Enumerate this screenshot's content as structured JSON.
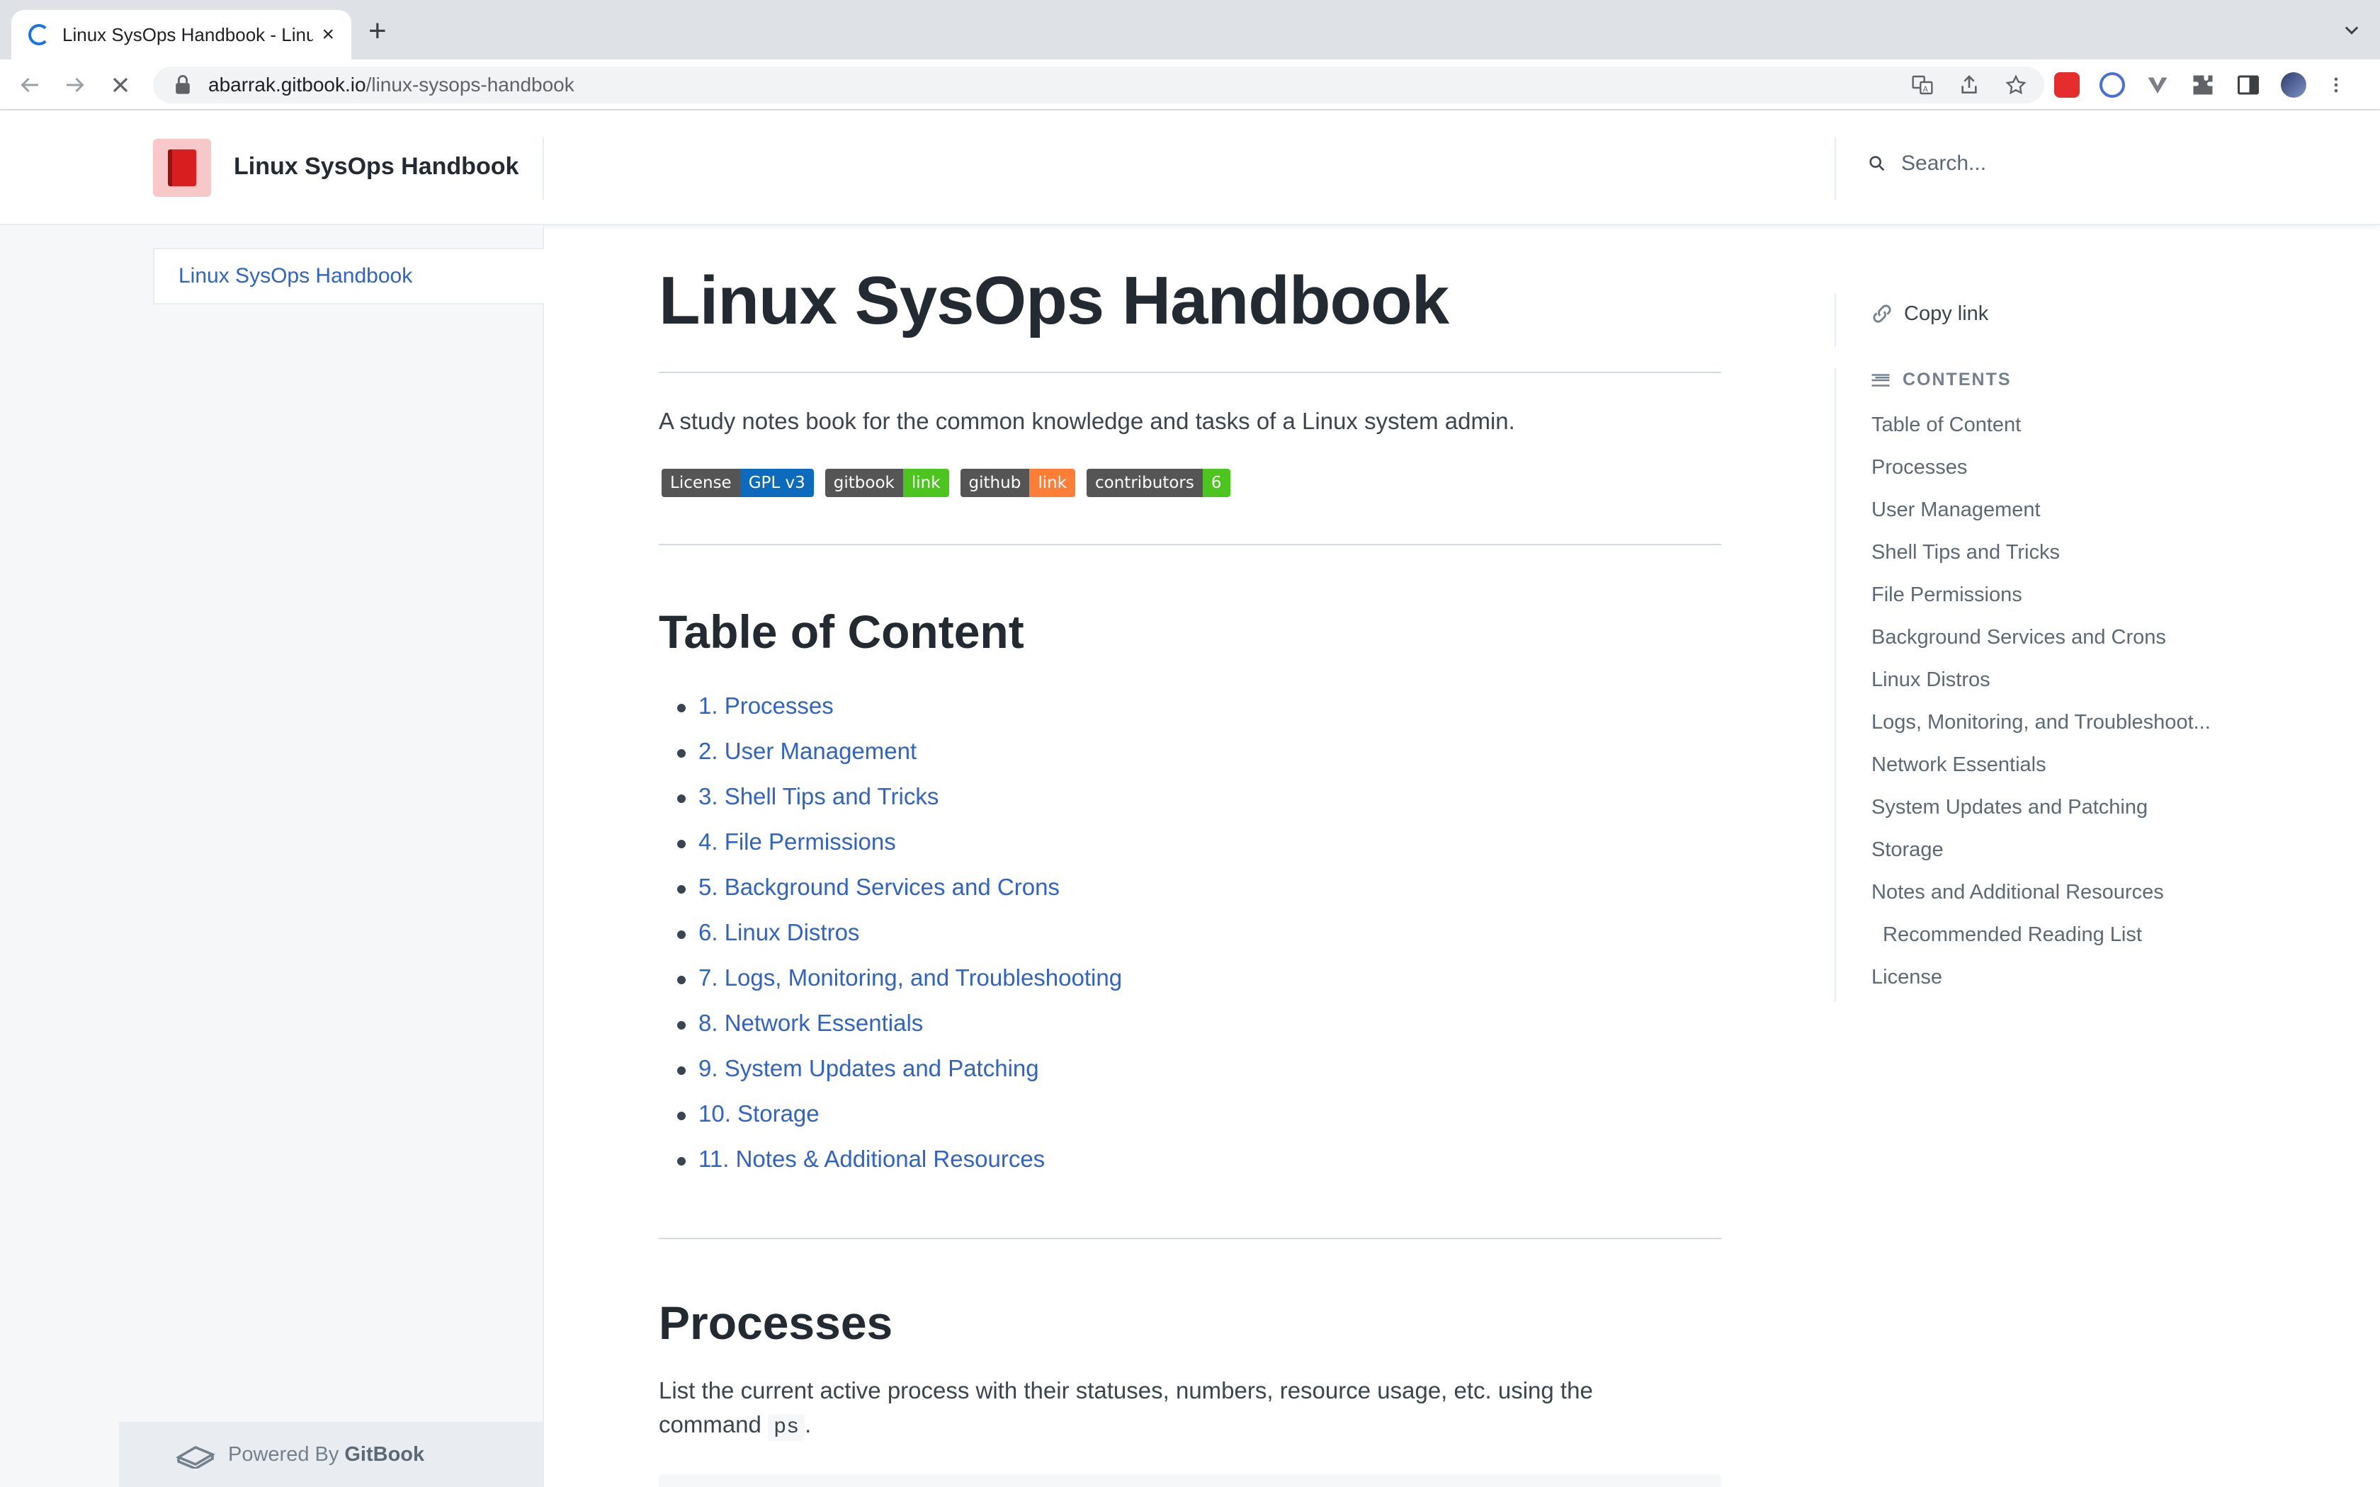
{
  "browser": {
    "tab_title": "Linux SysOps Handbook - Linux",
    "new_tab": "+",
    "tab_close": "×",
    "url_domain": "abarrak.gitbook.io",
    "url_path": "/linux-sysops-handbook"
  },
  "header": {
    "site_title": "Linux SysOps Handbook",
    "search_placeholder": "Search..."
  },
  "sidebar": {
    "items": [
      {
        "label": "Linux SysOps Handbook"
      }
    ],
    "powered_by": "Powered By",
    "powered_brand": "GitBook"
  },
  "main": {
    "title": "Linux SysOps Handbook",
    "intro": "A study notes book for the common knowledge and tasks of a Linux system admin.",
    "badges": [
      {
        "left": "License",
        "right": "GPL v3",
        "color": "#0d6bbd"
      },
      {
        "left": "gitbook",
        "right": "link",
        "color": "#4cc61e"
      },
      {
        "left": "github",
        "right": "link",
        "color": "#fe7d37"
      },
      {
        "left": "contributors",
        "right": "6",
        "color": "#4cc61e"
      }
    ],
    "toc_heading": "Table of Content",
    "toc": [
      "1. Processes",
      "2. User Management",
      "3. Shell Tips and Tricks",
      "4. File Permissions",
      "5. Background Services and Crons",
      "6. Linux Distros",
      "7. Logs, Monitoring, and Troubleshooting",
      "8. Network Essentials",
      "9. System Updates and Patching",
      "10. Storage",
      "11. Notes & Additional Resources"
    ],
    "section_heading": "Processes",
    "section_text_1": "List the current active process with their statuses, numbers, resource usage, etc. using the",
    "section_text_2": "command",
    "section_code": "ps",
    "section_text_3": "."
  },
  "right_toc": {
    "copy_link": "Copy link",
    "contents_label": "CONTENTS",
    "items": [
      "Table of Content",
      "Processes",
      "User Management",
      "Shell Tips and Tricks",
      "File Permissions",
      "Background Services and Crons",
      "Linux Distros",
      "Logs, Monitoring, and Troubleshoot...",
      "Network Essentials",
      "System Updates and Patching",
      "Storage",
      "Notes and Additional Resources",
      "Recommended Reading List",
      "License"
    ]
  },
  "colors": {
    "link": "#3063c9",
    "text": "#242a31",
    "sidebar_bg": "#f5f7f9",
    "accent_red": "#d81e1e"
  }
}
